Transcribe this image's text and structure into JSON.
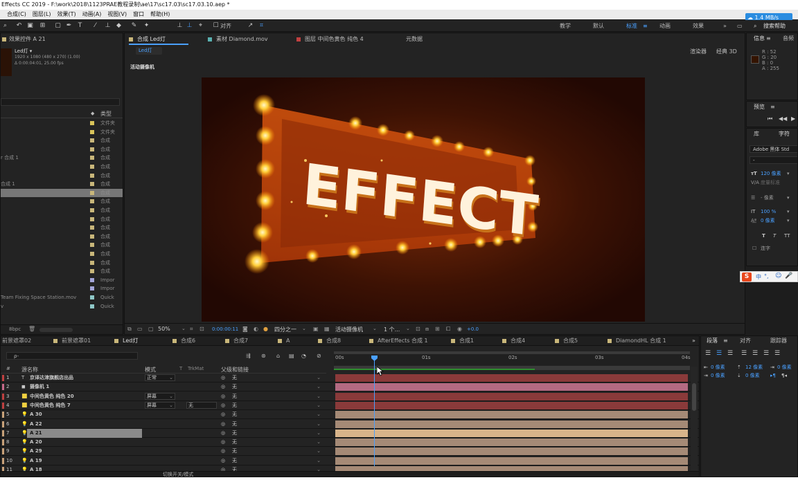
{
  "window": {
    "title": "Effects CC 2019 - F:\\work\\2018\\1123PRAE教程录制\\ae\\17\\sc17.03\\sc17.03.10.aep *"
  },
  "menu": [
    "合成(C)",
    "图层(L)",
    "效果(T)",
    "动画(A)",
    "视图(V)",
    "窗口",
    "帮助(H)"
  ],
  "net_badge": "1.4 MB/s",
  "search_help": "搜索帮助",
  "toolbar": {
    "align_label": "对齐",
    "workspaces": [
      "教学",
      "默认",
      "标准",
      "动画",
      "效果"
    ]
  },
  "effect_controls": {
    "tab": "效果控件 A 21",
    "comp_name": "Led灯",
    "dims": "1920 x 1080  (480 x 270) (1.00)",
    "duration": "Δ 0:00:04:01, 25.00 fps"
  },
  "project": {
    "type_header": "类型",
    "rows": [
      {
        "name": "",
        "color": "#d9c45a",
        "type": "文件夹"
      },
      {
        "name": "",
        "color": "#d9c45a",
        "type": "文件夹"
      },
      {
        "name": "",
        "color": "#c9b77a",
        "type": "合成"
      },
      {
        "name": "",
        "color": "#c9b77a",
        "type": "合成"
      },
      {
        "name": "r 合成 1",
        "color": "#c9b77a",
        "type": "合成"
      },
      {
        "name": "",
        "color": "#c9b77a",
        "type": "合成"
      },
      {
        "name": "",
        "color": "#c9b77a",
        "type": "合成"
      },
      {
        "name": "合成 1",
        "color": "#c9b77a",
        "type": "合成"
      },
      {
        "name": "",
        "color": "#c9b77a",
        "type": "合成"
      },
      {
        "name": "",
        "color": "#c9b77a",
        "type": "合成"
      },
      {
        "name": "",
        "color": "#c9b77a",
        "type": "合成"
      },
      {
        "name": "",
        "color": "#c9b77a",
        "type": "合成"
      },
      {
        "name": "",
        "color": "#c9b77a",
        "type": "合成"
      },
      {
        "name": "",
        "color": "#c9b77a",
        "type": "合成"
      },
      {
        "name": "",
        "color": "#c9b77a",
        "type": "合成"
      },
      {
        "name": "",
        "color": "#c9b77a",
        "type": "合成"
      },
      {
        "name": "",
        "color": "#c9b77a",
        "type": "合成"
      },
      {
        "name": "",
        "color": "#c9b77a",
        "type": "合成"
      },
      {
        "name": "",
        "color": "#a2a4d8",
        "type": "Impor"
      },
      {
        "name": "",
        "color": "#a2a4d8",
        "type": "Impor"
      },
      {
        "name": "Team Fixing Space Station.mov",
        "color": "#8fc8c8",
        "type": "Quick"
      },
      {
        "name": "v",
        "color": "#8fc8c8",
        "type": "Quick"
      }
    ],
    "bpc": "8bpc"
  },
  "comp_tabs": [
    {
      "label": "合成 Led灯",
      "color": "#c9b77a"
    },
    {
      "label": "素材 Diamond.mov",
      "color": "#5ab0b0"
    },
    {
      "label": "图层 中间色黄色 纯色 4",
      "color": "#c04040"
    },
    {
      "label": "元数据",
      "color": ""
    }
  ],
  "viewer": {
    "breadcrumb": "Led灯",
    "renderer_label": "渲染器",
    "renderer_value": "经典 3D",
    "camera_label": "活动摄像机",
    "headline": "EFFECT",
    "footer": {
      "zoom": "50%",
      "timecode": "0:00:00:11",
      "resolution": "四分之一",
      "camera": "活动摄像机",
      "views": "1 个...",
      "exposure": "+0.0"
    }
  },
  "info_panel": {
    "tabs": [
      "信息",
      "音频"
    ],
    "values": [
      "R : 52",
      "G : 20",
      "B : 0",
      "A : 255"
    ],
    "swatch": "#341400"
  },
  "preview_panel": {
    "title": "预览"
  },
  "character_panel": {
    "tabs": [
      "库",
      "字符"
    ],
    "font": "Adobe 黑体 Std",
    "style": "-",
    "size": "120 像素",
    "leading": "自动",
    "tracking_label": "度量标准",
    "stroke": "- 像素",
    "vscale": "100 %",
    "baseline": "0 像素",
    "ligature": "连字"
  },
  "paragraph_panel": {
    "tabs": [
      "段落",
      "对齐",
      "跟踪器"
    ],
    "indent1": "0 像素",
    "indent2": "12 像素",
    "indent3": "0 像素",
    "indent4": "0 像素",
    "indent5": "0 像素"
  },
  "timeline_tabs": [
    {
      "label": "前景遮罩02",
      "color": ""
    },
    {
      "label": "前景遮罩01",
      "color": "#c9b77a"
    },
    {
      "label": "Led灯",
      "color": "#c9b77a"
    },
    {
      "label": "合成6",
      "color": "#c9b77a"
    },
    {
      "label": "合成7",
      "color": "#c9b77a"
    },
    {
      "label": "A",
      "color": "#c9b77a"
    },
    {
      "label": "合成8",
      "color": "#c9b77a"
    },
    {
      "label": "AfterEffects 合成 1",
      "color": "#c9b77a"
    },
    {
      "label": "合成1",
      "color": "#c9b77a"
    },
    {
      "label": "合成4",
      "color": "#c9b77a"
    },
    {
      "label": "合成5",
      "color": "#c9b77a"
    },
    {
      "label": "DiamondHL 合成 1",
      "color": "#c9b77a"
    }
  ],
  "timeline": {
    "search_placeholder": "ρ-",
    "headers": {
      "num": "#",
      "name": "源名称",
      "mode": "模式",
      "t": "T",
      "trkmat": "TrkMat",
      "parent": "父级和链接"
    },
    "ruler": [
      "00s",
      "01s",
      "02s",
      "03s",
      "04s"
    ],
    "playhead_fraction": 0.11,
    "rows": [
      {
        "num": "1",
        "label_color": "#c04040",
        "icon": "T",
        "name": "京译达津旗舰店出品",
        "mode": "正常",
        "trk": "",
        "parent": "无",
        "bar": "#8a3a3a"
      },
      {
        "num": "2",
        "label_color": "#c86a8a",
        "icon": "cam",
        "name": "摄像机 1",
        "mode": "",
        "trk": "",
        "parent": "无",
        "bar": "#b46a82"
      },
      {
        "num": "3",
        "label_color": "#c04040",
        "icon": "solid",
        "name": "中间色黄色 纯色 20",
        "mode": "屏幕",
        "trk": "",
        "parent": "无",
        "bar": "#8a3a3a"
      },
      {
        "num": "4",
        "label_color": "#c04040",
        "icon": "solid",
        "name": "中间色黄色 纯色 7",
        "mode": "屏幕",
        "trk": "无",
        "parent": "无",
        "bar": "#8a3a3a"
      },
      {
        "num": "5",
        "label_color": "#c9a27a",
        "icon": "light",
        "name": "A 30",
        "mode": "",
        "trk": "",
        "parent": "无",
        "bar": "#a58a76"
      },
      {
        "num": "6",
        "label_color": "#c9a27a",
        "icon": "light",
        "name": "A 22",
        "mode": "",
        "trk": "",
        "parent": "无",
        "bar": "#a58a76"
      },
      {
        "num": "7",
        "label_color": "#c9a27a",
        "icon": "light",
        "name": "A 21",
        "mode": "",
        "trk": "",
        "parent": "无",
        "bar": "#d8b48a",
        "selected": true
      },
      {
        "num": "8",
        "label_color": "#c9a27a",
        "icon": "light",
        "name": "A 20",
        "mode": "",
        "trk": "",
        "parent": "无",
        "bar": "#a58a76"
      },
      {
        "num": "9",
        "label_color": "#c9a27a",
        "icon": "light",
        "name": "A 29",
        "mode": "",
        "trk": "",
        "parent": "无",
        "bar": "#a58a76"
      },
      {
        "num": "10",
        "label_color": "#c9a27a",
        "icon": "light",
        "name": "A 19",
        "mode": "",
        "trk": "",
        "parent": "无",
        "bar": "#a58a76"
      },
      {
        "num": "11",
        "label_color": "#c9a27a",
        "icon": "light",
        "name": "A 18",
        "mode": "",
        "trk": "",
        "parent": "无",
        "bar": "#a58a76"
      }
    ],
    "bottom_label": "切换开关/模式"
  },
  "ime_toolbar": [
    "中",
    "°,"
  ]
}
